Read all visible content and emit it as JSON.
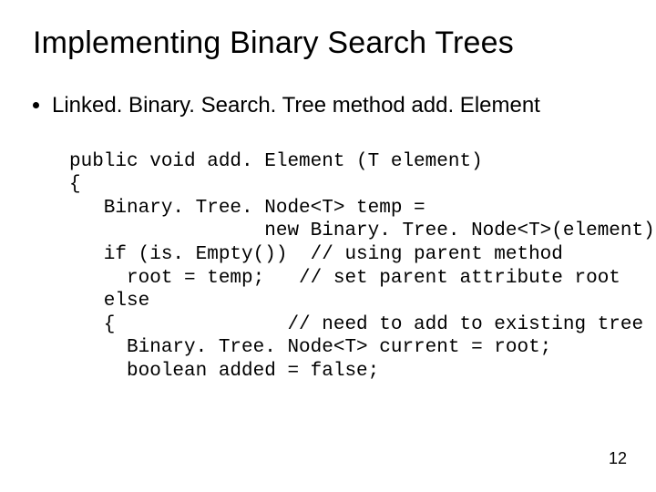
{
  "title": "Implementing Binary Search Trees",
  "bullet": "Linked. Binary. Search. Tree method add. Element",
  "code_lines": {
    "l0": "public void add. Element (T element)",
    "l1": "{",
    "l2": "   Binary. Tree. Node<T> temp =",
    "l3": "                 new Binary. Tree. Node<T>(element);",
    "l4": "   if (is. Empty())  // using parent method",
    "l5": "     root = temp;   // set parent attribute root",
    "l6": "   else",
    "l7": "   {               // need to add to existing tree",
    "l8": "     Binary. Tree. Node<T> current = root;",
    "l9": "     boolean added = false;"
  },
  "page_number": "12"
}
